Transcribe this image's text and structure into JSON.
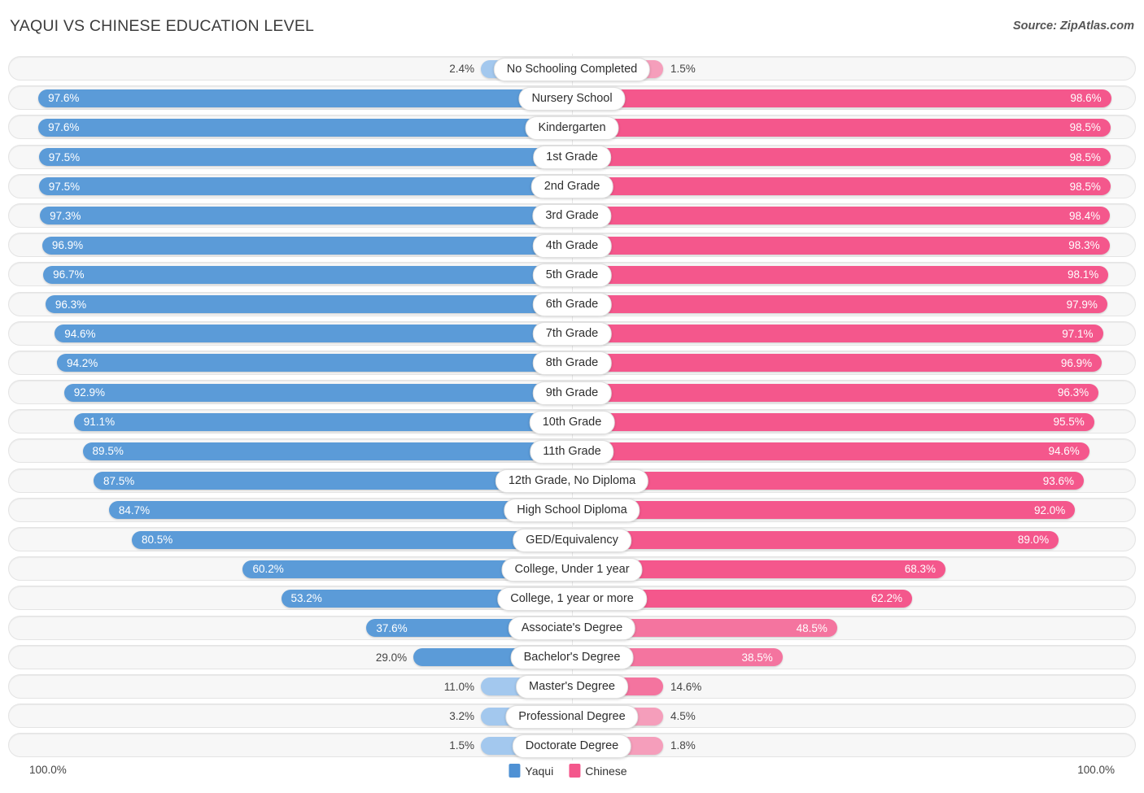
{
  "header": {
    "title": "YAQUI VS CHINESE EDUCATION LEVEL",
    "source": "Source: ZipAtlas.com"
  },
  "legend": {
    "left": {
      "label": "Yaqui",
      "color": "#4f91d4"
    },
    "right": {
      "label": "Chinese",
      "color": "#f4578c"
    }
  },
  "axis": {
    "left_max": "100.0%",
    "right_max": "100.0%"
  },
  "colors": {
    "blue_strong": "#5b9bd8",
    "blue_light": "#a3c8ee",
    "pink_strong": "#f4578c",
    "pink_mid": "#f4749f",
    "pink_light": "#f59ebb",
    "track": "#f7f7f7"
  },
  "chart_data": {
    "type": "bar",
    "title": "YAQUI VS CHINESE EDUCATION LEVEL",
    "subtitle": "Source: ZipAtlas.com",
    "orientation": "horizontal-diverging",
    "xlabel": "",
    "ylabel": "",
    "xlim": [
      0,
      100
    ],
    "grid": false,
    "legend_position": "bottom-center",
    "categories": [
      "No Schooling Completed",
      "Nursery School",
      "Kindergarten",
      "1st Grade",
      "2nd Grade",
      "3rd Grade",
      "4th Grade",
      "5th Grade",
      "6th Grade",
      "7th Grade",
      "8th Grade",
      "9th Grade",
      "10th Grade",
      "11th Grade",
      "12th Grade, No Diploma",
      "High School Diploma",
      "GED/Equivalency",
      "College, Under 1 year",
      "College, 1 year or more",
      "Associate's Degree",
      "Bachelor's Degree",
      "Master's Degree",
      "Professional Degree",
      "Doctorate Degree"
    ],
    "series": [
      {
        "name": "Yaqui",
        "color": "#5b9bd8",
        "values": [
          2.4,
          97.6,
          97.6,
          97.5,
          97.5,
          97.3,
          96.9,
          96.7,
          96.3,
          94.6,
          94.2,
          92.9,
          91.1,
          89.5,
          87.5,
          84.7,
          80.5,
          60.2,
          53.2,
          37.6,
          29.0,
          11.0,
          3.2,
          1.5
        ],
        "labels": [
          "2.4%",
          "97.6%",
          "97.6%",
          "97.5%",
          "97.5%",
          "97.3%",
          "96.9%",
          "96.7%",
          "96.3%",
          "94.6%",
          "94.2%",
          "92.9%",
          "91.1%",
          "89.5%",
          "87.5%",
          "84.7%",
          "80.5%",
          "60.2%",
          "53.2%",
          "37.6%",
          "29.0%",
          "11.0%",
          "3.2%",
          "1.5%"
        ]
      },
      {
        "name": "Chinese",
        "color": "#f4578c",
        "values": [
          1.5,
          98.6,
          98.5,
          98.5,
          98.5,
          98.4,
          98.3,
          98.1,
          97.9,
          97.1,
          96.9,
          96.3,
          95.5,
          94.6,
          93.6,
          92.0,
          89.0,
          68.3,
          62.2,
          48.5,
          38.5,
          14.6,
          4.5,
          1.8
        ],
        "labels": [
          "1.5%",
          "98.6%",
          "98.5%",
          "98.5%",
          "98.5%",
          "98.4%",
          "98.3%",
          "98.1%",
          "97.9%",
          "97.1%",
          "96.9%",
          "96.3%",
          "95.5%",
          "94.6%",
          "93.6%",
          "92.0%",
          "89.0%",
          "68.3%",
          "62.2%",
          "48.5%",
          "38.5%",
          "14.6%",
          "4.5%",
          "1.8%"
        ]
      }
    ]
  }
}
